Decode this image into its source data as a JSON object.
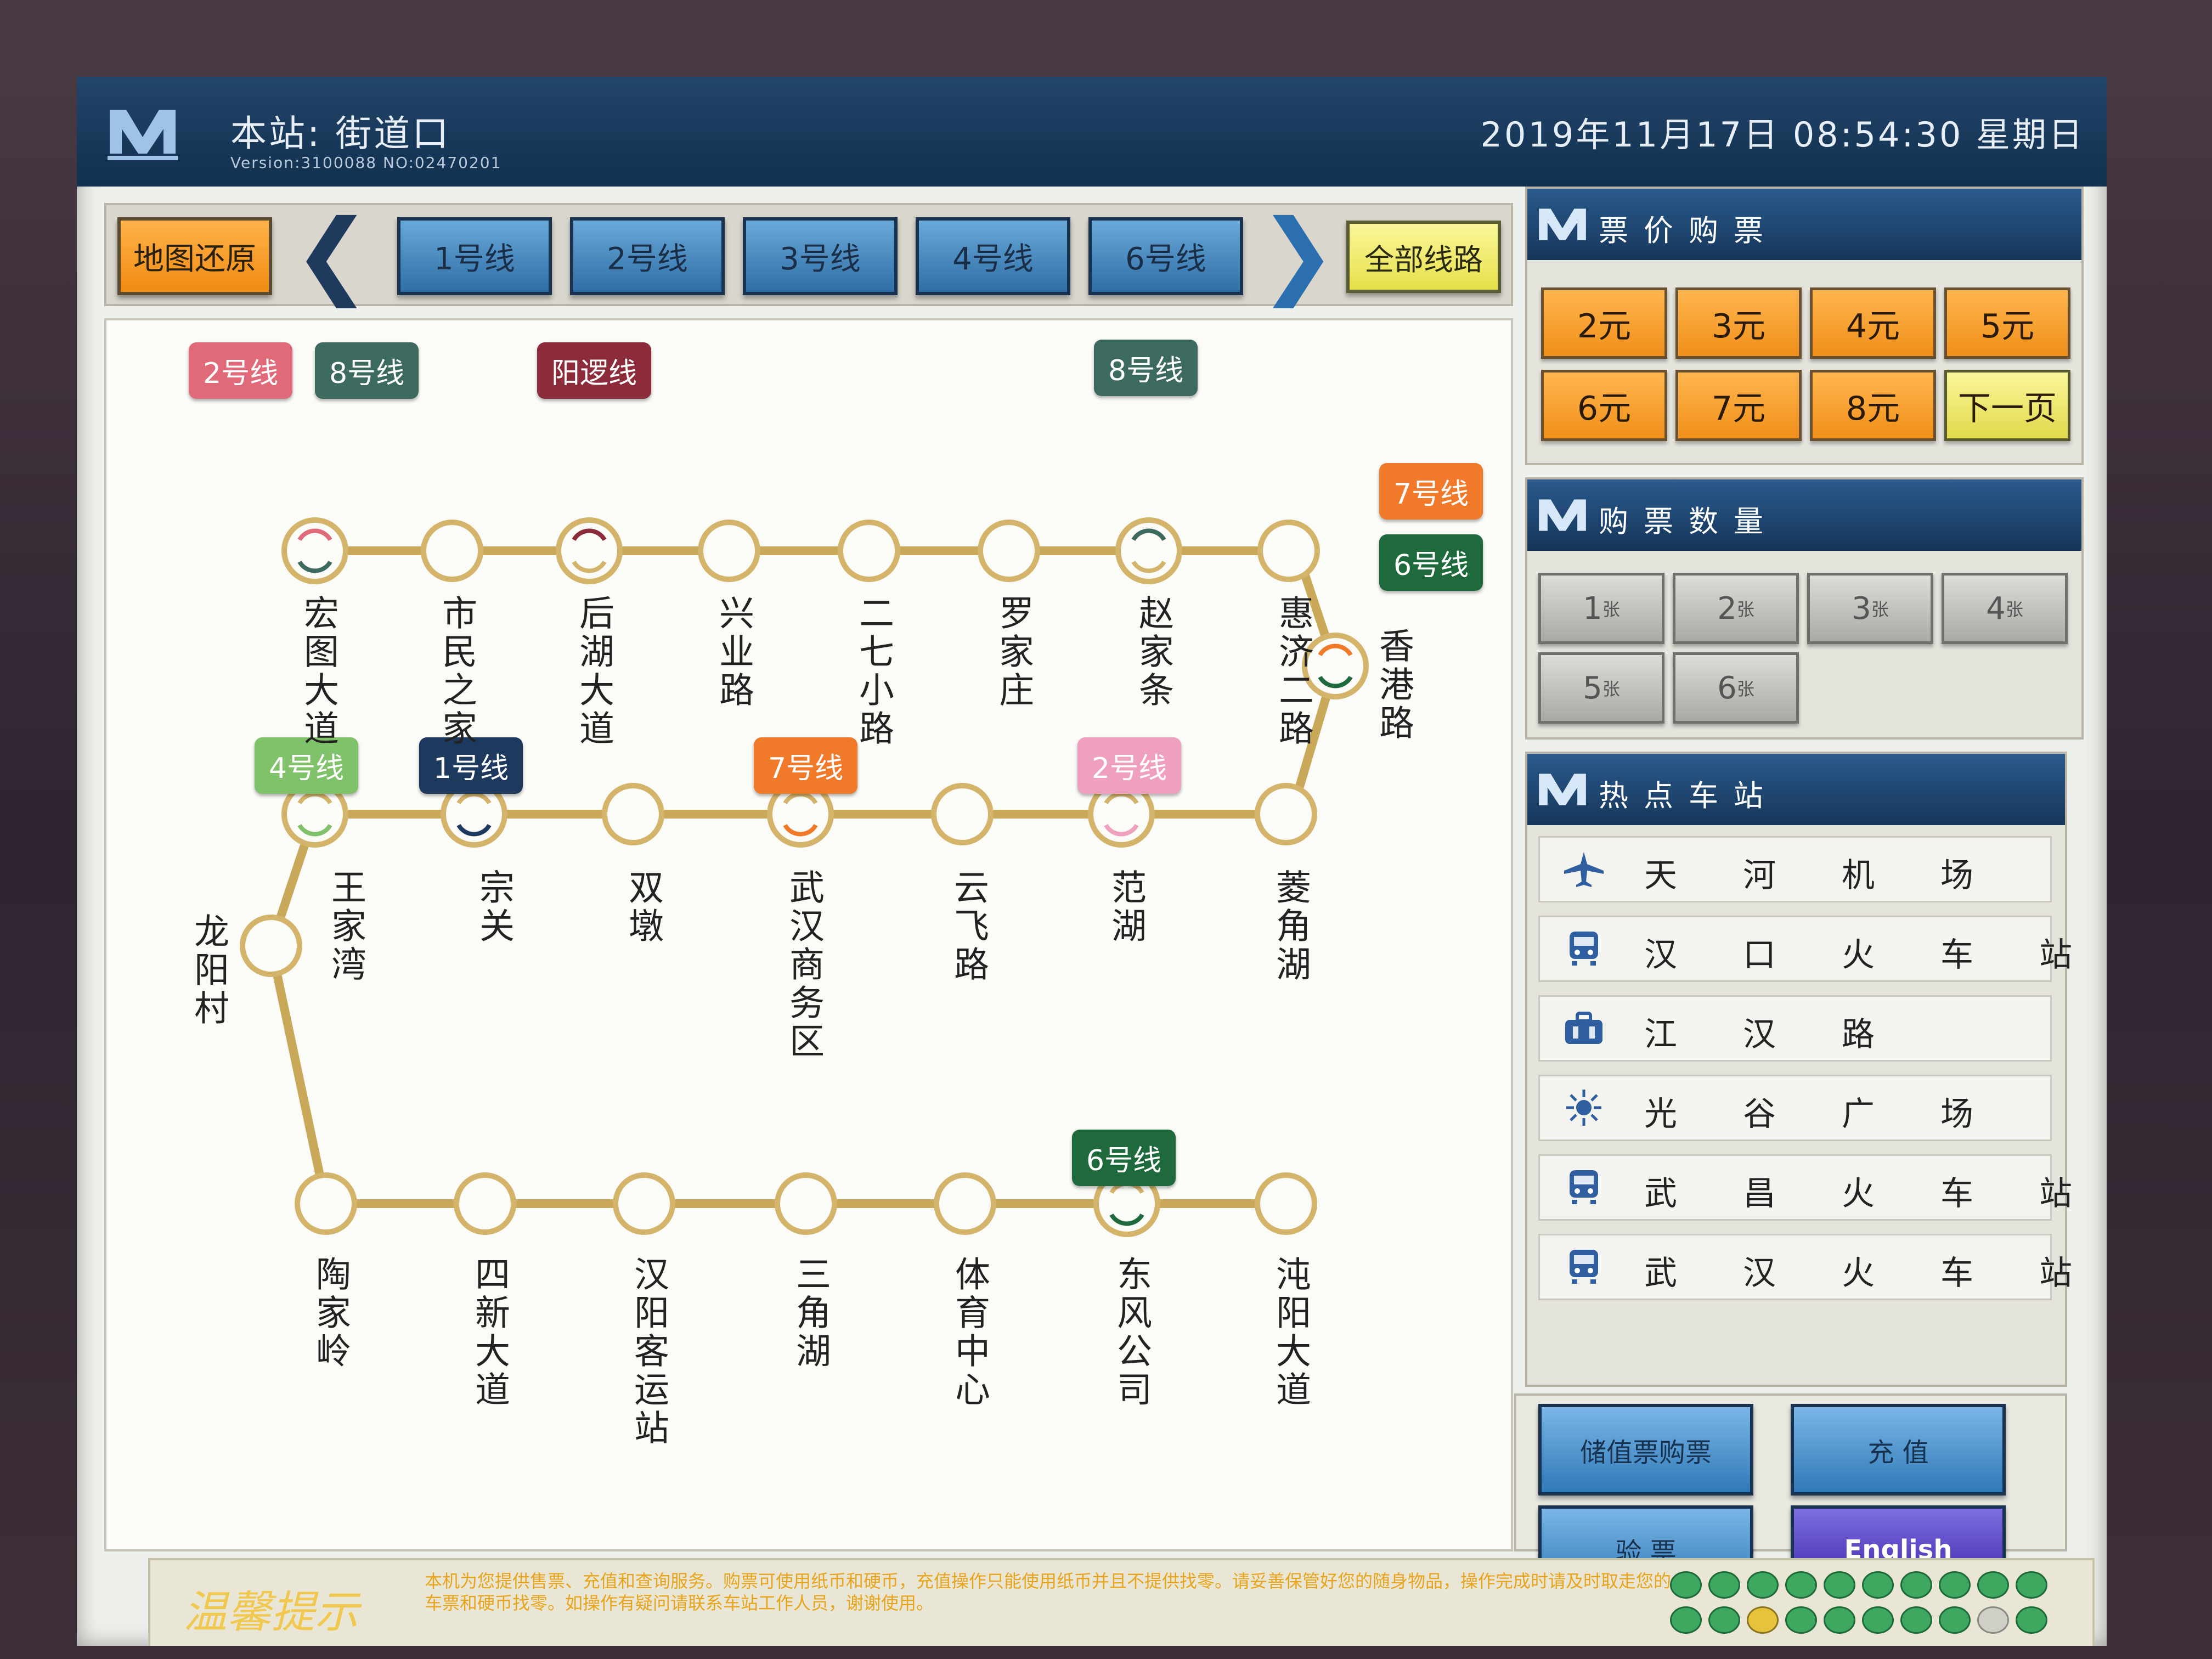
{
  "header": {
    "station": "本站: 街道口",
    "version": "Version:3100088   NO:02470201",
    "datetime": "2019年11月17日  08:54:30  星期日"
  },
  "nav": {
    "reset": "地图还原",
    "lines": [
      "1号线",
      "2号线",
      "3号线",
      "4号线",
      "6号线"
    ],
    "all_lines": "全部线路"
  },
  "map": {
    "stations_row1": [
      "宏图大道",
      "市民之家",
      "后湖大道",
      "兴业路",
      "二七小路",
      "罗家庄",
      "赵家条",
      "惠济二路"
    ],
    "station_xianggang": "香港路",
    "stations_row2": [
      "王家湾",
      "宗关",
      "双墩",
      "武汉商务区",
      "云飞路",
      "范湖",
      "菱角湖"
    ],
    "station_longyang": "龙阳村",
    "stations_row3": [
      "陶家岭",
      "四新大道",
      "汉阳客运站",
      "三角湖",
      "体育中心",
      "东风公司",
      "沌阳大道"
    ],
    "transfer_tags": {
      "hongtu_a": "2号线",
      "hongtu_b": "8号线",
      "houhu": "阳逻线",
      "zhaojiatiao": "8号线",
      "xianggang_a": "7号线",
      "xianggang_b": "6号线",
      "wangjiawan": "4号线",
      "zongguan": "1号线",
      "shangwuqu": "7号线",
      "fanhu": "2号线",
      "dongfeng": "6号线"
    },
    "colors": {
      "line": "#c9a85a",
      "line2": "#e06a7a",
      "line8": "#3d6a5e",
      "yangluo": "#8c2b3a",
      "line7": "#f07a2a",
      "line6": "#1f6a3c",
      "line4": "#7fc26a",
      "line1": "#1d3a5e",
      "line2b": "#f0a0bf"
    }
  },
  "ticket_price": {
    "title": "票价购票",
    "prices": [
      "2元",
      "3元",
      "4元",
      "5元",
      "6元",
      "7元",
      "8元"
    ],
    "next": "下一页"
  },
  "ticket_qty": {
    "title": "购票数量",
    "options": [
      {
        "n": "1",
        "u": "张"
      },
      {
        "n": "2",
        "u": "张"
      },
      {
        "n": "3",
        "u": "张"
      },
      {
        "n": "4",
        "u": "张"
      },
      {
        "n": "5",
        "u": "张"
      },
      {
        "n": "6",
        "u": "张"
      }
    ]
  },
  "hot_stations": {
    "title": "热点车站",
    "items": [
      {
        "name": "天河机场",
        "icon": "airplane-icon"
      },
      {
        "name": "汉口火车站",
        "icon": "train-icon"
      },
      {
        "name": "江汉路",
        "icon": "bag-icon"
      },
      {
        "name": "光谷广场",
        "icon": "star-icon"
      },
      {
        "name": "武昌火车站",
        "icon": "train-icon"
      },
      {
        "name": "武汉火车站",
        "icon": "train-icon"
      }
    ]
  },
  "actions": {
    "stored_value": "储值票购票",
    "recharge": "充 值",
    "check": "验 票",
    "english": "English"
  },
  "footer": {
    "tip_title": "温馨提示",
    "tip_text": "本机为您提供售票、充值和查询服务。购票可使用纸币和硬币，充值操作只能使用纸币并且不提供找零。请妥善保管好您的随身物品，操作完成时请及时取走您的车票和硬币找零。如操作有疑问请联系车站工作人员，谢谢使用。"
  }
}
